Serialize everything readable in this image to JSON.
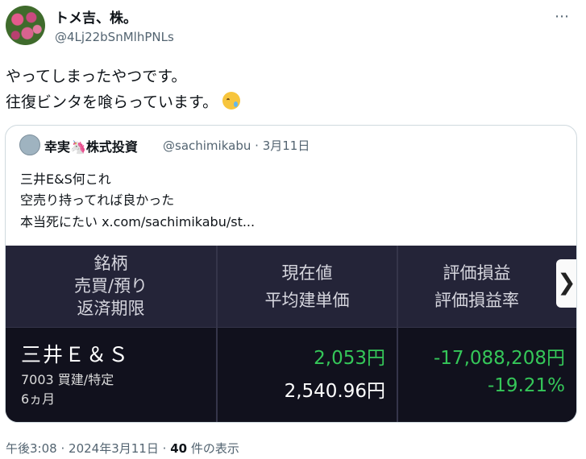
{
  "header": {
    "display_name": "トメ吉、株。",
    "handle": "@4Lj22bSnMlhPNLs",
    "more_icon": "⋯"
  },
  "tweet": {
    "line1": "やってしまったやつです。",
    "line2": "往復ビンタを喰らっています。",
    "emoji": "crying-face-emoji"
  },
  "quote": {
    "name": "幸実🦄株式投資",
    "handle": "@sachimikabu",
    "separator": "·",
    "date": "3月11日",
    "line1": "三井E&S何これ",
    "line2": "空売り持ってれば良かった",
    "line3": "本当死にたい  x.com/sachimikabu/st..."
  },
  "table": {
    "col1_header": [
      "銘柄",
      "売買/預り",
      "返済期限"
    ],
    "col2_header": [
      "現在値",
      "平均建単価"
    ],
    "col3_header": [
      "評価損益",
      "評価損益率"
    ],
    "next_arrow": "❯",
    "row": {
      "name": "三井Ｅ＆Ｓ",
      "code_type": "7003 買建/特定",
      "term": "6ヵ月",
      "current_price": "2,053円",
      "avg_price": "2,540.96円",
      "pnl": "-17,088,208円",
      "pnl_rate": "-19.21%"
    }
  },
  "footer": {
    "time": "午後3:08",
    "dot1": "·",
    "date": "2024年3月11日",
    "dot2": "·",
    "views_count": "40",
    "views_label": "件の表示"
  },
  "colors": {
    "text_primary": "#0f1419",
    "text_secondary": "#536471",
    "gain_green": "#35c759",
    "table_bg": "#11111d"
  }
}
